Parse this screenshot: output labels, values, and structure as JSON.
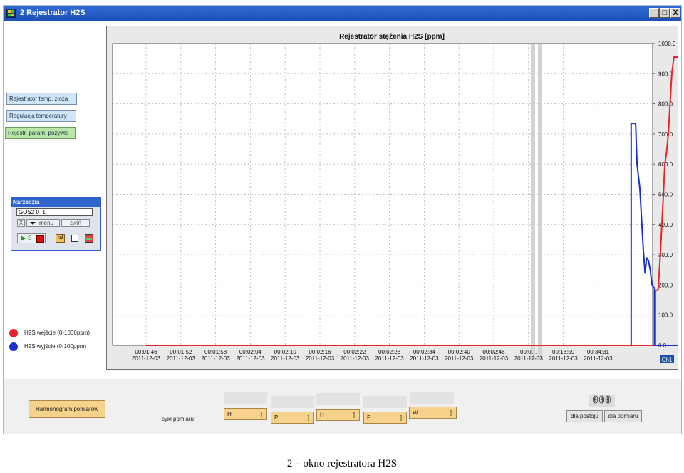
{
  "window": {
    "title": "2  Rejestrator H2S",
    "controls": {
      "minimize": "_",
      "maximize": "□",
      "close": "X"
    }
  },
  "sidebar": {
    "buttons": [
      {
        "label": "Rejestrator temp. złoża"
      },
      {
        "label": "Regulacja temperatury"
      },
      {
        "label": "Rejestr. param. pożywki"
      }
    ]
  },
  "tools": {
    "title": "Narzedzia",
    "field_value": "GOS2 0_1",
    "close_label": "X",
    "menu_label": "menu",
    "collapse_label": "zwiń",
    "start_label": "S",
    "tool_label": "ral"
  },
  "legend": [
    {
      "label": "H2S wejście  (0-1000ppm)",
      "color": "#e8242a"
    },
    {
      "label": "H2S wyjście  (0-100ppm)",
      "color": "#1b2fd0"
    }
  ],
  "chart_data": {
    "type": "line",
    "title": "Rejestrator stężenia H2S  [ppm]",
    "xlabel": "",
    "ylabel": "",
    "ylim": [
      0,
      1000
    ],
    "y_ticks": [
      "1000.0",
      "900.0",
      "800.0",
      "700.0",
      "600.0",
      "500.0",
      "400.0",
      "300.0",
      "200.0",
      "100.0",
      "0.0"
    ],
    "x_ticks": [
      {
        "time": "00:01:46",
        "date": "2011-12-03"
      },
      {
        "time": "00:01:52",
        "date": "2011-12-03"
      },
      {
        "time": "00:01:58",
        "date": "2011-12-03"
      },
      {
        "time": "00:02:04",
        "date": "2011-12-03"
      },
      {
        "time": "00:02:10",
        "date": "2011-12-03"
      },
      {
        "time": "00:02:16",
        "date": "2011-12-03"
      },
      {
        "time": "00:02:22",
        "date": "2011-12-03"
      },
      {
        "time": "00:02:28",
        "date": "2011-12-03"
      },
      {
        "time": "00:02:34",
        "date": "2011-12-03"
      },
      {
        "time": "00:02:40",
        "date": "2011-12-03"
      },
      {
        "time": "00:02:46",
        "date": "2011-12-03"
      },
      {
        "time": "00:0…",
        "date": "2011-12-03"
      },
      {
        "time": "00:18:59",
        "date": "2011-12-03"
      },
      {
        "time": "00:34:31",
        "date": "2011-12-03"
      }
    ],
    "channel_label": "Ch1",
    "grid": true,
    "series": [
      {
        "name": "H2S wejście  (0-1000ppm)",
        "color": "#e8242a",
        "points": [
          [
            0,
            0
          ],
          [
            14.65,
            0
          ],
          [
            14.65,
            180
          ],
          [
            14.73,
            185
          ],
          [
            14.8,
            320
          ],
          [
            14.88,
            500
          ],
          [
            14.92,
            600
          ],
          [
            14.97,
            640
          ],
          [
            15.02,
            700
          ],
          [
            15.07,
            800
          ],
          [
            15.12,
            900
          ],
          [
            15.18,
            955
          ],
          [
            15.3,
            955
          ],
          [
            15.38,
            950
          ],
          [
            15.38,
            0
          ],
          [
            15.7,
            0
          ]
        ]
      },
      {
        "name": "H2S wyjście  (0-100ppm)",
        "color": "#1b2fd0",
        "points": [
          [
            13.95,
            0
          ],
          [
            13.95,
            735
          ],
          [
            14.08,
            735
          ],
          [
            14.12,
            600
          ],
          [
            14.2,
            520
          ],
          [
            14.25,
            420
          ],
          [
            14.3,
            320
          ],
          [
            14.35,
            240
          ],
          [
            14.4,
            290
          ],
          [
            14.45,
            280
          ],
          [
            14.5,
            250
          ],
          [
            14.55,
            200
          ],
          [
            14.62,
            190
          ],
          [
            14.62,
            0
          ],
          [
            15.5,
            0
          ]
        ]
      }
    ]
  },
  "footer": {
    "schedule_button": "Harmonogram pomiarów",
    "cycle_label": "cykl pomiaru",
    "cycle_fields": [
      "H",
      "P",
      "H",
      "P",
      "W"
    ],
    "bracket": "]",
    "counter_display": "000",
    "idle_button": "dla postoju",
    "measure_button": "dla pomiaru"
  },
  "caption": "2 – okno rejestratora H2S"
}
